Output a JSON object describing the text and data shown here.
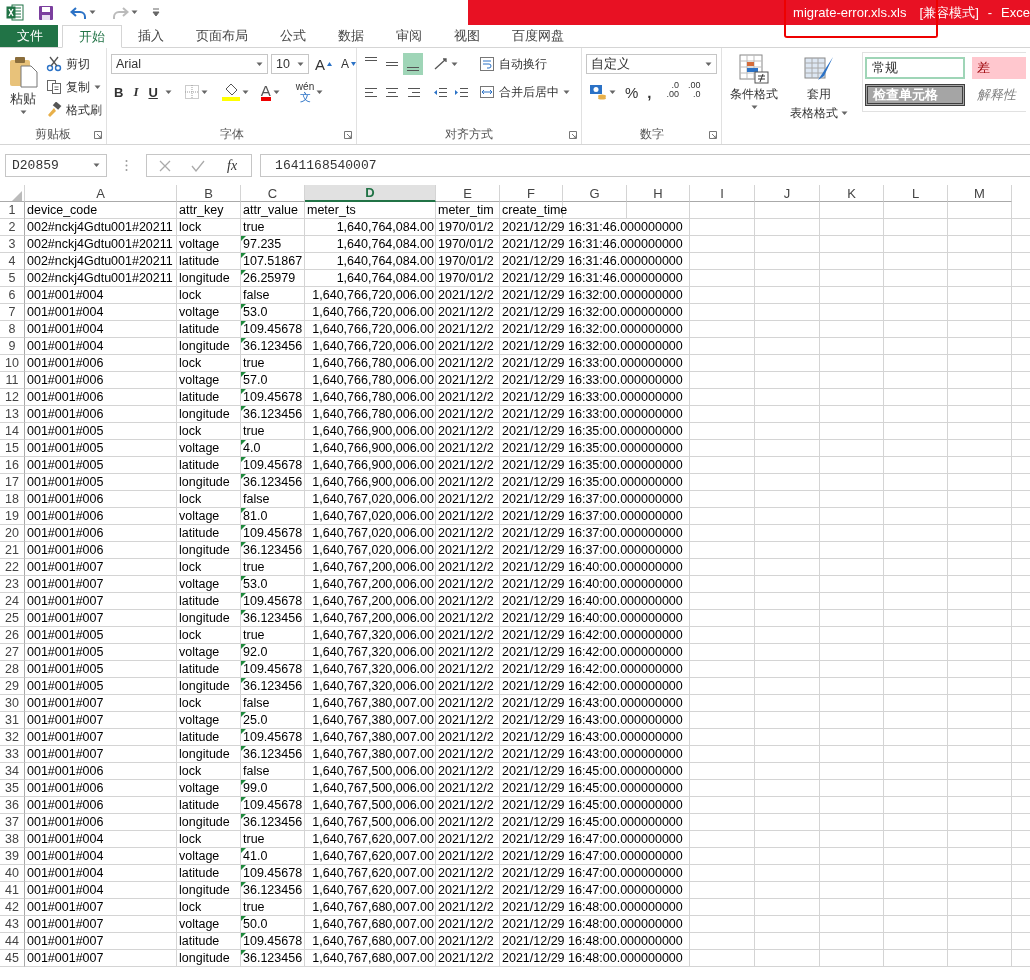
{
  "title_bar": {
    "filename": "migrate-error.xls.xls",
    "mode": "[兼容模式]",
    "separator": "-",
    "app": "Exce",
    "highlighted": true
  },
  "tabs": [
    {
      "label": "文件",
      "kind": "file",
      "selected": false
    },
    {
      "label": "开始",
      "kind": "tab",
      "selected": true
    },
    {
      "label": "插入",
      "kind": "tab",
      "selected": false
    },
    {
      "label": "页面布局",
      "kind": "tab",
      "selected": false
    },
    {
      "label": "公式",
      "kind": "tab",
      "selected": false
    },
    {
      "label": "数据",
      "kind": "tab",
      "selected": false
    },
    {
      "label": "审阅",
      "kind": "tab",
      "selected": false
    },
    {
      "label": "视图",
      "kind": "tab",
      "selected": false
    },
    {
      "label": "百度网盘",
      "kind": "tab",
      "selected": false
    }
  ],
  "ribbon": {
    "clipboard": {
      "label": "剪贴板",
      "paste": "粘贴",
      "cut": "剪切",
      "copy": "复制",
      "format_painter": "格式刷"
    },
    "font": {
      "label": "字体",
      "font_name": "Arial",
      "font_size": "10",
      "grow": "A",
      "shrink": "A",
      "bold": "B",
      "italic": "I",
      "underline": "U",
      "font_color": "A",
      "phonetic_top": "wén",
      "phonetic_bottom": "文"
    },
    "alignment": {
      "label": "对齐方式",
      "wrap_text": "自动换行",
      "merge_center": "合并后居中"
    },
    "number": {
      "label": "数字",
      "format": "自定义",
      "percent": "%",
      "comma": ",",
      "decimals": [
        {
          "top": ".0",
          "bottom": ".00"
        },
        {
          "top": ".00",
          "bottom": ".0"
        }
      ]
    },
    "styles": {
      "conditional": "条件格式",
      "table_top": "套用",
      "table_bottom": "表格格式",
      "cells": [
        {
          "label": "常规",
          "kind": "normal"
        },
        {
          "label": "差",
          "kind": "bad"
        },
        {
          "label": "检查单元格",
          "kind": "check"
        },
        {
          "label": "解释性",
          "kind": "explanatory"
        }
      ]
    }
  },
  "formula_bar": {
    "name_box": "D20859",
    "function_label": "fx",
    "formula": "1641168540007"
  },
  "columns": [
    {
      "label": "A",
      "selected": false
    },
    {
      "label": "B",
      "selected": false
    },
    {
      "label": "C",
      "selected": false
    },
    {
      "label": "D",
      "selected": true
    },
    {
      "label": "E",
      "selected": false
    },
    {
      "label": "F",
      "selected": false
    },
    {
      "label": "G",
      "selected": false
    },
    {
      "label": "H",
      "selected": false
    },
    {
      "label": "I",
      "selected": false
    },
    {
      "label": "J",
      "selected": false
    },
    {
      "label": "K",
      "selected": false
    },
    {
      "label": "L",
      "selected": false
    },
    {
      "label": "M",
      "selected": false
    }
  ],
  "rows": [
    {
      "number": "1",
      "kind": "header",
      "flagged": false,
      "cells": [
        "device_code",
        "attr_key",
        "attr_value",
        "meter_ts",
        "meter_tim",
        "create_time"
      ]
    },
    {
      "number": "2",
      "kind": "data",
      "flagged": false,
      "cells": [
        "002#nckj4Gdtu001#20211",
        "lock",
        "true",
        "1,640,764,084.00",
        "1970/01/2",
        "2021/12/29 16:31:46.000000000"
      ]
    },
    {
      "number": "3",
      "kind": "data",
      "flagged": true,
      "cells": [
        "002#nckj4Gdtu001#20211",
        "voltage",
        "97.235",
        "1,640,764,084.00",
        "1970/01/2",
        "2021/12/29 16:31:46.000000000"
      ]
    },
    {
      "number": "4",
      "kind": "data",
      "flagged": true,
      "cells": [
        "002#nckj4Gdtu001#20211",
        "latitude",
        "107.51867",
        "1,640,764,084.00",
        "1970/01/2",
        "2021/12/29 16:31:46.000000000"
      ]
    },
    {
      "number": "5",
      "kind": "data",
      "flagged": true,
      "cells": [
        "002#nckj4Gdtu001#20211",
        "longitude",
        "26.25979",
        "1,640,764,084.00",
        "1970/01/2",
        "2021/12/29 16:31:46.000000000"
      ]
    },
    {
      "number": "6",
      "kind": "data",
      "flagged": false,
      "cells": [
        "001#001#004",
        "lock",
        "false",
        "1,640,766,720,006.00",
        "2021/12/2",
        "2021/12/29 16:32:00.000000000"
      ]
    },
    {
      "number": "7",
      "kind": "data",
      "flagged": true,
      "cells": [
        "001#001#004",
        "voltage",
        "53.0",
        "1,640,766,720,006.00",
        "2021/12/2",
        "2021/12/29 16:32:00.000000000"
      ]
    },
    {
      "number": "8",
      "kind": "data",
      "flagged": true,
      "cells": [
        "001#001#004",
        "latitude",
        "109.45678",
        "1,640,766,720,006.00",
        "2021/12/2",
        "2021/12/29 16:32:00.000000000"
      ]
    },
    {
      "number": "9",
      "kind": "data",
      "flagged": true,
      "cells": [
        "001#001#004",
        "longitude",
        "36.123456",
        "1,640,766,720,006.00",
        "2021/12/2",
        "2021/12/29 16:32:00.000000000"
      ]
    },
    {
      "number": "10",
      "kind": "data",
      "flagged": false,
      "cells": [
        "001#001#006",
        "lock",
        "true",
        "1,640,766,780,006.00",
        "2021/12/2",
        "2021/12/29 16:33:00.000000000"
      ]
    },
    {
      "number": "11",
      "kind": "data",
      "flagged": true,
      "cells": [
        "001#001#006",
        "voltage",
        "57.0",
        "1,640,766,780,006.00",
        "2021/12/2",
        "2021/12/29 16:33:00.000000000"
      ]
    },
    {
      "number": "12",
      "kind": "data",
      "flagged": true,
      "cells": [
        "001#001#006",
        "latitude",
        "109.45678",
        "1,640,766,780,006.00",
        "2021/12/2",
        "2021/12/29 16:33:00.000000000"
      ]
    },
    {
      "number": "13",
      "kind": "data",
      "flagged": true,
      "cells": [
        "001#001#006",
        "longitude",
        "36.123456",
        "1,640,766,780,006.00",
        "2021/12/2",
        "2021/12/29 16:33:00.000000000"
      ]
    },
    {
      "number": "14",
      "kind": "data",
      "flagged": false,
      "cells": [
        "001#001#005",
        "lock",
        "true",
        "1,640,766,900,006.00",
        "2021/12/2",
        "2021/12/29 16:35:00.000000000"
      ]
    },
    {
      "number": "15",
      "kind": "data",
      "flagged": true,
      "cells": [
        "001#001#005",
        "voltage",
        "4.0",
        "1,640,766,900,006.00",
        "2021/12/2",
        "2021/12/29 16:35:00.000000000"
      ]
    },
    {
      "number": "16",
      "kind": "data",
      "flagged": true,
      "cells": [
        "001#001#005",
        "latitude",
        "109.45678",
        "1,640,766,900,006.00",
        "2021/12/2",
        "2021/12/29 16:35:00.000000000"
      ]
    },
    {
      "number": "17",
      "kind": "data",
      "flagged": true,
      "cells": [
        "001#001#005",
        "longitude",
        "36.123456",
        "1,640,766,900,006.00",
        "2021/12/2",
        "2021/12/29 16:35:00.000000000"
      ]
    },
    {
      "number": "18",
      "kind": "data",
      "flagged": false,
      "cells": [
        "001#001#006",
        "lock",
        "false",
        "1,640,767,020,006.00",
        "2021/12/2",
        "2021/12/29 16:37:00.000000000"
      ]
    },
    {
      "number": "19",
      "kind": "data",
      "flagged": true,
      "cells": [
        "001#001#006",
        "voltage",
        "81.0",
        "1,640,767,020,006.00",
        "2021/12/2",
        "2021/12/29 16:37:00.000000000"
      ]
    },
    {
      "number": "20",
      "kind": "data",
      "flagged": true,
      "cells": [
        "001#001#006",
        "latitude",
        "109.45678",
        "1,640,767,020,006.00",
        "2021/12/2",
        "2021/12/29 16:37:00.000000000"
      ]
    },
    {
      "number": "21",
      "kind": "data",
      "flagged": true,
      "cells": [
        "001#001#006",
        "longitude",
        "36.123456",
        "1,640,767,020,006.00",
        "2021/12/2",
        "2021/12/29 16:37:00.000000000"
      ]
    },
    {
      "number": "22",
      "kind": "data",
      "flagged": false,
      "cells": [
        "001#001#007",
        "lock",
        "true",
        "1,640,767,200,006.00",
        "2021/12/2",
        "2021/12/29 16:40:00.000000000"
      ]
    },
    {
      "number": "23",
      "kind": "data",
      "flagged": true,
      "cells": [
        "001#001#007",
        "voltage",
        "53.0",
        "1,640,767,200,006.00",
        "2021/12/2",
        "2021/12/29 16:40:00.000000000"
      ]
    },
    {
      "number": "24",
      "kind": "data",
      "flagged": true,
      "cells": [
        "001#001#007",
        "latitude",
        "109.45678",
        "1,640,767,200,006.00",
        "2021/12/2",
        "2021/12/29 16:40:00.000000000"
      ]
    },
    {
      "number": "25",
      "kind": "data",
      "flagged": true,
      "cells": [
        "001#001#007",
        "longitude",
        "36.123456",
        "1,640,767,200,006.00",
        "2021/12/2",
        "2021/12/29 16:40:00.000000000"
      ]
    },
    {
      "number": "26",
      "kind": "data",
      "flagged": false,
      "cells": [
        "001#001#005",
        "lock",
        "true",
        "1,640,767,320,006.00",
        "2021/12/2",
        "2021/12/29 16:42:00.000000000"
      ]
    },
    {
      "number": "27",
      "kind": "data",
      "flagged": true,
      "cells": [
        "001#001#005",
        "voltage",
        "92.0",
        "1,640,767,320,006.00",
        "2021/12/2",
        "2021/12/29 16:42:00.000000000"
      ]
    },
    {
      "number": "28",
      "kind": "data",
      "flagged": true,
      "cells": [
        "001#001#005",
        "latitude",
        "109.45678",
        "1,640,767,320,006.00",
        "2021/12/2",
        "2021/12/29 16:42:00.000000000"
      ]
    },
    {
      "number": "29",
      "kind": "data",
      "flagged": true,
      "cells": [
        "001#001#005",
        "longitude",
        "36.123456",
        "1,640,767,320,006.00",
        "2021/12/2",
        "2021/12/29 16:42:00.000000000"
      ]
    },
    {
      "number": "30",
      "kind": "data",
      "flagged": false,
      "cells": [
        "001#001#007",
        "lock",
        "false",
        "1,640,767,380,007.00",
        "2021/12/2",
        "2021/12/29 16:43:00.000000000"
      ]
    },
    {
      "number": "31",
      "kind": "data",
      "flagged": true,
      "cells": [
        "001#001#007",
        "voltage",
        "25.0",
        "1,640,767,380,007.00",
        "2021/12/2",
        "2021/12/29 16:43:00.000000000"
      ]
    },
    {
      "number": "32",
      "kind": "data",
      "flagged": true,
      "cells": [
        "001#001#007",
        "latitude",
        "109.45678",
        "1,640,767,380,007.00",
        "2021/12/2",
        "2021/12/29 16:43:00.000000000"
      ]
    },
    {
      "number": "33",
      "kind": "data",
      "flagged": true,
      "cells": [
        "001#001#007",
        "longitude",
        "36.123456",
        "1,640,767,380,007.00",
        "2021/12/2",
        "2021/12/29 16:43:00.000000000"
      ]
    },
    {
      "number": "34",
      "kind": "data",
      "flagged": false,
      "cells": [
        "001#001#006",
        "lock",
        "false",
        "1,640,767,500,006.00",
        "2021/12/2",
        "2021/12/29 16:45:00.000000000"
      ]
    },
    {
      "number": "35",
      "kind": "data",
      "flagged": true,
      "cells": [
        "001#001#006",
        "voltage",
        "99.0",
        "1,640,767,500,006.00",
        "2021/12/2",
        "2021/12/29 16:45:00.000000000"
      ]
    },
    {
      "number": "36",
      "kind": "data",
      "flagged": true,
      "cells": [
        "001#001#006",
        "latitude",
        "109.45678",
        "1,640,767,500,006.00",
        "2021/12/2",
        "2021/12/29 16:45:00.000000000"
      ]
    },
    {
      "number": "37",
      "kind": "data",
      "flagged": true,
      "cells": [
        "001#001#006",
        "longitude",
        "36.123456",
        "1,640,767,500,006.00",
        "2021/12/2",
        "2021/12/29 16:45:00.000000000"
      ]
    },
    {
      "number": "38",
      "kind": "data",
      "flagged": false,
      "cells": [
        "001#001#004",
        "lock",
        "true",
        "1,640,767,620,007.00",
        "2021/12/2",
        "2021/12/29 16:47:00.000000000"
      ]
    },
    {
      "number": "39",
      "kind": "data",
      "flagged": true,
      "cells": [
        "001#001#004",
        "voltage",
        "41.0",
        "1,640,767,620,007.00",
        "2021/12/2",
        "2021/12/29 16:47:00.000000000"
      ]
    },
    {
      "number": "40",
      "kind": "data",
      "flagged": true,
      "cells": [
        "001#001#004",
        "latitude",
        "109.45678",
        "1,640,767,620,007.00",
        "2021/12/2",
        "2021/12/29 16:47:00.000000000"
      ]
    },
    {
      "number": "41",
      "kind": "data",
      "flagged": true,
      "cells": [
        "001#001#004",
        "longitude",
        "36.123456",
        "1,640,767,620,007.00",
        "2021/12/2",
        "2021/12/29 16:47:00.000000000"
      ]
    },
    {
      "number": "42",
      "kind": "data",
      "flagged": false,
      "cells": [
        "001#001#007",
        "lock",
        "true",
        "1,640,767,680,007.00",
        "2021/12/2",
        "2021/12/29 16:48:00.000000000"
      ]
    },
    {
      "number": "43",
      "kind": "data",
      "flagged": true,
      "cells": [
        "001#001#007",
        "voltage",
        "50.0",
        "1,640,767,680,007.00",
        "2021/12/2",
        "2021/12/29 16:48:00.000000000"
      ]
    },
    {
      "number": "44",
      "kind": "data",
      "flagged": true,
      "cells": [
        "001#001#007",
        "latitude",
        "109.45678",
        "1,640,767,680,007.00",
        "2021/12/2",
        "2021/12/29 16:48:00.000000000"
      ]
    },
    {
      "number": "45",
      "kind": "data",
      "flagged": true,
      "cells": [
        "001#001#007",
        "longitude",
        "36.123456",
        "1,640,767,680,007.00",
        "2021/12/2",
        "2021/12/29 16:48:00.000000000"
      ]
    }
  ]
}
